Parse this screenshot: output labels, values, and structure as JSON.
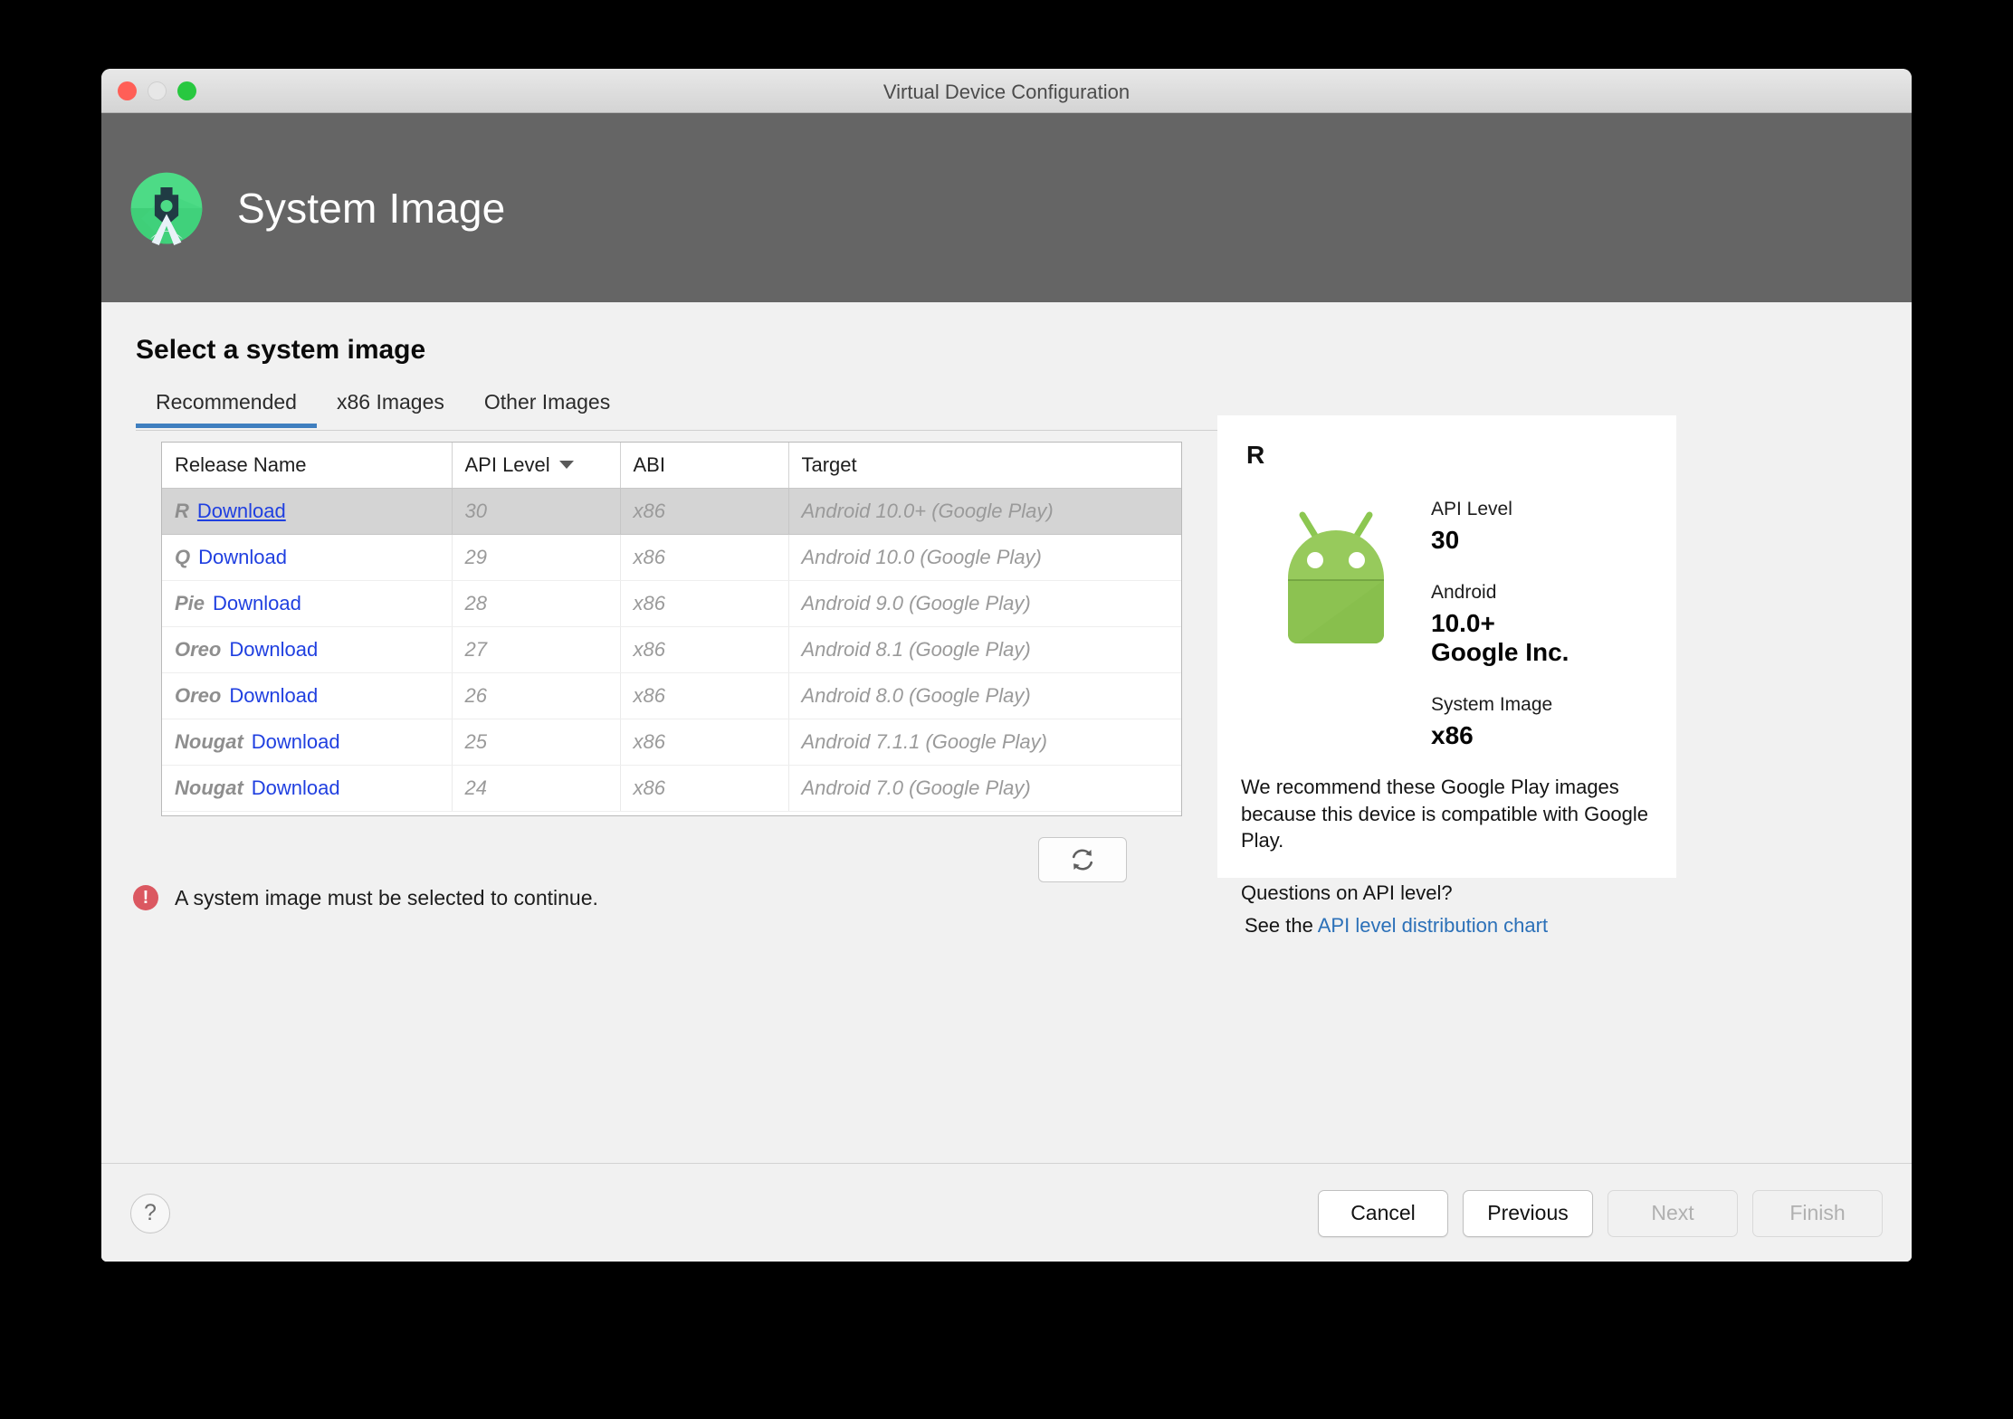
{
  "window": {
    "title": "Virtual Device Configuration",
    "traffic_lights": [
      "close",
      "minimize",
      "maximize"
    ]
  },
  "header": {
    "title": "System Image",
    "logo_icon": "android-studio-logo-icon"
  },
  "main": {
    "heading": "Select a system image",
    "tabs": [
      {
        "label": "Recommended",
        "active": true
      },
      {
        "label": "x86 Images",
        "active": false
      },
      {
        "label": "Other Images",
        "active": false
      }
    ],
    "table": {
      "columns": [
        "Release Name",
        "API Level",
        "ABI",
        "Target"
      ],
      "sort_column": "API Level",
      "sort_direction": "descending",
      "download_label": "Download",
      "rows": [
        {
          "release": "R",
          "api": "30",
          "abi": "x86",
          "target": "Android 10.0+ (Google Play)",
          "action": "Download",
          "selected": true
        },
        {
          "release": "Q",
          "api": "29",
          "abi": "x86",
          "target": "Android 10.0 (Google Play)",
          "action": "Download",
          "selected": false
        },
        {
          "release": "Pie",
          "api": "28",
          "abi": "x86",
          "target": "Android 9.0 (Google Play)",
          "action": "Download",
          "selected": false
        },
        {
          "release": "Oreo",
          "api": "27",
          "abi": "x86",
          "target": "Android 8.1 (Google Play)",
          "action": "Download",
          "selected": false
        },
        {
          "release": "Oreo",
          "api": "26",
          "abi": "x86",
          "target": "Android 8.0 (Google Play)",
          "action": "Download",
          "selected": false
        },
        {
          "release": "Nougat",
          "api": "25",
          "abi": "x86",
          "target": "Android 7.1.1 (Google Play)",
          "action": "Download",
          "selected": false
        },
        {
          "release": "Nougat",
          "api": "24",
          "abi": "x86",
          "target": "Android 7.0 (Google Play)",
          "action": "Download",
          "selected": false
        }
      ]
    },
    "refresh_button": {
      "icon": "refresh-icon"
    },
    "error": {
      "icon": "error-circle-icon",
      "message": "A system image must be selected to continue.",
      "color": "#db5861"
    }
  },
  "detail": {
    "release_letter": "R",
    "robot_icon": "android-robot-icon",
    "specs": [
      {
        "label": "API Level",
        "value": "30"
      },
      {
        "label": "Android",
        "value": "10.0+",
        "value2": "Google Inc."
      },
      {
        "label": "System Image",
        "value": "x86"
      }
    ],
    "recommendation": "We recommend these Google Play images because this device is compatible with Google Play.",
    "question": "Questions on API level?",
    "see_prefix": "See the ",
    "link_label": "API level distribution chart",
    "link_color": "#2b70b8"
  },
  "footer": {
    "help_label": "?",
    "buttons": [
      {
        "label": "Cancel",
        "enabled": true
      },
      {
        "label": "Previous",
        "enabled": true
      },
      {
        "label": "Next",
        "enabled": false
      },
      {
        "label": "Finish",
        "enabled": false
      }
    ]
  },
  "colors": {
    "accent_tab": "#3f7fbf",
    "link": "#1f3fe0",
    "header_bg": "#656565",
    "error": "#db5861"
  }
}
